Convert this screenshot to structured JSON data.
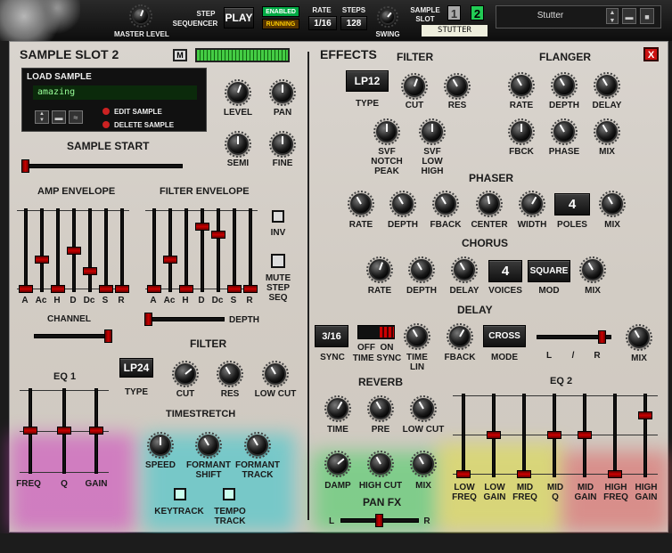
{
  "topbar": {
    "master_level_label": "MASTER LEVEL",
    "step_sequencer_label1": "STEP",
    "step_sequencer_label2": "SEQUENCER",
    "play_label": "PLAY",
    "enabled_label": "ENABLED",
    "running_label": "RUNNING",
    "rate_label": "RATE",
    "rate_value": "1/16",
    "steps_label": "STEPS",
    "steps_value": "128",
    "swing_label": "SWING",
    "sample_slot_label1": "SAMPLE",
    "sample_slot_label2": "SLOT",
    "slot1": "1",
    "slot2": "2",
    "slot_name": "STUTTER",
    "preset_name": "Stutter"
  },
  "left": {
    "title": "SAMPLE SLOT 2",
    "m_button": "M",
    "load_sample": "LOAD SAMPLE",
    "sample_name": "amazing",
    "edit_sample": "EDIT SAMPLE",
    "delete_sample": "DELETE SAMPLE",
    "level": "LEVEL",
    "pan": "PAN",
    "semi": "SEMI",
    "fine": "FINE",
    "sample_start": "SAMPLE START",
    "amp_envelope": "AMP ENVELOPE",
    "filter_envelope": "FILTER ENVELOPE",
    "env_labels": [
      "A",
      "Ac",
      "H",
      "D",
      "Dc",
      "S",
      "R"
    ],
    "inv": "INV",
    "mute_step_seq": [
      "MUTE",
      "STEP",
      "SEQ"
    ],
    "channel": "CHANNEL",
    "depth": "DEPTH",
    "filter_title": "FILTER",
    "filter_type": "LP24",
    "type": "TYPE",
    "cut": "CUT",
    "res": "RES",
    "low_cut": "LOW CUT",
    "eq1": "EQ 1",
    "eq1_labels": [
      "FREQ",
      "Q",
      "GAIN"
    ],
    "timestretch": "TIMESTRETCH",
    "speed": "SPEED",
    "formant_shift": [
      "FORMANT",
      "SHIFT"
    ],
    "formant_track": [
      "FORMANT",
      "TRACK"
    ],
    "keytrack": "KEYTRACK",
    "tempo_track": [
      "TEMPO",
      "TRACK"
    ]
  },
  "effects": {
    "title": "EFFECTS",
    "close": "X",
    "filter": {
      "title": "FILTER",
      "type_value": "LP12",
      "type": "TYPE",
      "cut": "CUT",
      "res": "RES",
      "svf_notch_peak": [
        "SVF",
        "NOTCH",
        "PEAK"
      ],
      "svf_low_high": [
        "SVF",
        "LOW",
        "HIGH"
      ]
    },
    "flanger": {
      "title": "FLANGER",
      "rate": "RATE",
      "depth": "DEPTH",
      "delay": "DELAY",
      "fbck": "FBCK",
      "phase": "PHASE",
      "mix": "MIX"
    },
    "phaser": {
      "title": "PHASER",
      "rate": "RATE",
      "depth": "DEPTH",
      "fback": "FBACK",
      "center": "CENTER",
      "width": "WIDTH",
      "poles_value": "4",
      "poles": "POLES",
      "mix": "MIX"
    },
    "chorus": {
      "title": "CHORUS",
      "rate": "RATE",
      "depth": "DEPTH",
      "delay": "DELAY",
      "voices_value": "4",
      "voices": "VOICES",
      "mod_value": "SQUARE",
      "mod": "MOD",
      "mix": "MIX"
    },
    "delay": {
      "title": "DELAY",
      "sync_value": "3/16",
      "sync": "SYNC",
      "off": "OFF",
      "on": "ON",
      "time_sync": "TIME SYNC",
      "time_lin": [
        "TIME",
        "LIN"
      ],
      "fback": "FBACK",
      "mode_value": "CROSS",
      "mode": "MODE",
      "l": "L",
      "slash": "/",
      "r": "R",
      "mix": "MIX"
    },
    "reverb": {
      "title": "REVERB",
      "time": "TIME",
      "pre": "PRE",
      "low_cut": "LOW CUT",
      "damp": "DAMP",
      "high_cut": "HIGH CUT",
      "mix": "MIX"
    },
    "eq2": {
      "title": "EQ 2",
      "labels": [
        [
          "LOW",
          "FREQ"
        ],
        [
          "LOW",
          "GAIN"
        ],
        [
          "MID",
          "FREQ"
        ],
        [
          "MID",
          "Q"
        ],
        [
          "MID",
          "GAIN"
        ],
        [
          "HIGH",
          "FREQ"
        ],
        [
          "HIGH",
          "GAIN"
        ]
      ]
    },
    "pan_fx": {
      "title": "PAN FX",
      "l": "L",
      "r": "R"
    }
  }
}
